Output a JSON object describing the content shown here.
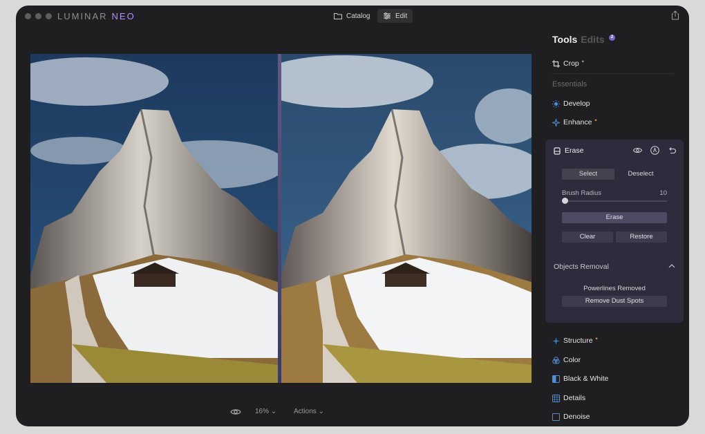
{
  "app": {
    "brand_main": "LUMINAR",
    "brand_sub": "NEO"
  },
  "topbar": {
    "catalog_label": "Catalog",
    "edit_label": "Edit"
  },
  "bottombar": {
    "zoom": "16%",
    "actions_label": "Actions"
  },
  "panel": {
    "tab_tools": "Tools",
    "tab_edits": "Edits",
    "edits_badge": "2",
    "crop_label": "Crop",
    "section_essentials": "Essentials",
    "develop_label": "Develop",
    "enhance_label": "Enhance",
    "erase": {
      "title": "Erase",
      "select_label": "Select",
      "deselect_label": "Deselect",
      "brush_radius_label": "Brush Radius",
      "brush_radius_value": "10",
      "erase_button": "Erase",
      "clear_button": "Clear",
      "restore_button": "Restore",
      "objects_removal_label": "Objects Removal",
      "powerlines_status": "Powerlines Removed",
      "dust_button": "Remove Dust Spots"
    },
    "tools": [
      {
        "label": "Structure"
      },
      {
        "label": "Color"
      },
      {
        "label": "Black & White"
      },
      {
        "label": "Details"
      },
      {
        "label": "Denoise"
      }
    ]
  },
  "colors": {
    "accent": "#4c8fe0",
    "star": "#e7a43c",
    "brand_neo": "#b68cff"
  }
}
